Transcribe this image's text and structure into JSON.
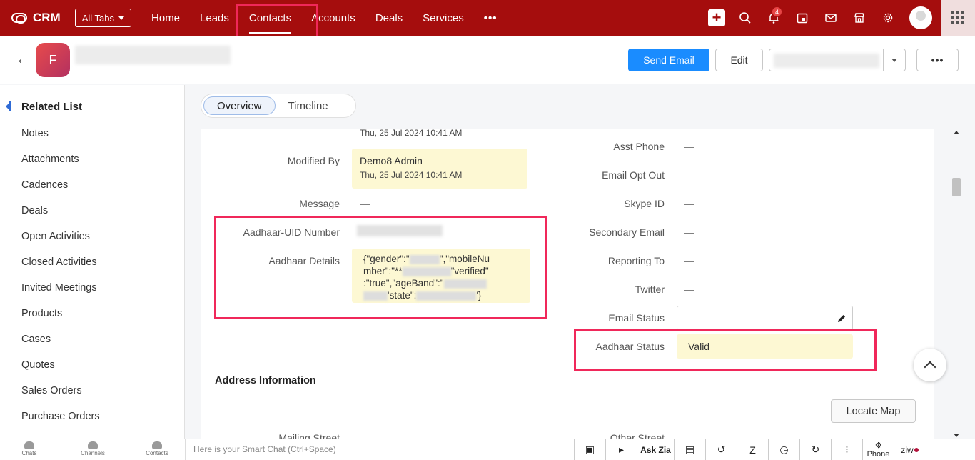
{
  "topbar": {
    "app_name": "CRM",
    "all_tabs_label": "All Tabs",
    "tabs": [
      {
        "label": "Home"
      },
      {
        "label": "Leads"
      },
      {
        "label": "Contacts"
      },
      {
        "label": "Accounts"
      },
      {
        "label": "Deals"
      },
      {
        "label": "Services"
      }
    ],
    "more_label": "•••",
    "notification_count": "4",
    "brand_color": "#a50d0d"
  },
  "record": {
    "avatar_initial": "F",
    "send_email_label": "Send Email",
    "edit_label": "Edit",
    "more_label": "•••"
  },
  "sidebar": {
    "heading": "Related List",
    "items": [
      "Notes",
      "Attachments",
      "Cadences",
      "Deals",
      "Open Activities",
      "Closed Activities",
      "Invited Meetings",
      "Products",
      "Cases",
      "Quotes",
      "Sales Orders",
      "Purchase Orders"
    ]
  },
  "page_tabs": {
    "overview": "Overview",
    "timeline": "Timeline"
  },
  "details": {
    "created_time": "Thu, 25 Jul 2024 10:41 AM",
    "modified_by_label": "Modified By",
    "modified_by_value": "Demo8 Admin",
    "modified_time": "Thu, 25 Jul 2024 10:41 AM",
    "message_label": "Message",
    "message_value": "—",
    "aadhaar_uid_label": "Aadhaar-UID Number",
    "aadhaar_details_label": "Aadhaar Details",
    "aadhaar_details_line1": "{\"gender\":\"",
    "aadhaar_details_line1b": "\",\"mobileNu",
    "aadhaar_details_line2": "mber\":\"**",
    "aadhaar_details_line2b": "\"verified\"",
    "aadhaar_details_line3": ":\"true\",\"ageBand\":\"",
    "aadhaar_details_line4": "'state\":",
    "aadhaar_details_line4b": "'}",
    "asst_phone_label": "Asst Phone",
    "email_opt_out_label": "Email Opt Out",
    "skype_id_label": "Skype ID",
    "secondary_email_label": "Secondary Email",
    "reporting_to_label": "Reporting To",
    "twitter_label": "Twitter",
    "email_status_label": "Email Status",
    "aadhaar_status_label": "Aadhaar Status",
    "aadhaar_status_value": "Valid",
    "empty_value": "—"
  },
  "address": {
    "section_title": "Address Information",
    "locate_map_label": "Locate Map",
    "mailing_street_label": "Mailing Street",
    "other_street_label": "Other Street"
  },
  "bottombar": {
    "chats": "Chats",
    "channels": "Channels",
    "contacts": "Contacts",
    "smart_chat_placeholder": "Here is your Smart Chat (Ctrl+Space)",
    "ask_zia": "Ask Zia",
    "phone": "Phone",
    "ziwo": "ziw"
  }
}
